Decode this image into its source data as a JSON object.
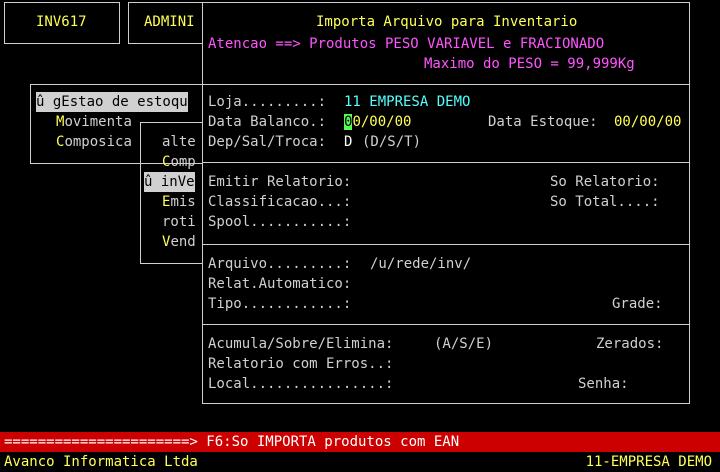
{
  "top_tabs": [
    {
      "label": "INV617"
    },
    {
      "label": "ADMINI"
    }
  ],
  "menu_l1": {
    "selected": "û gEstao de estoqu",
    "items": [
      {
        "hot": "M",
        "rest": "ovimenta"
      },
      {
        "hot": "C",
        "rest": "omposica"
      }
    ]
  },
  "menu_l2": {
    "items": [
      {
        "hot": "",
        "rest": "alte"
      },
      {
        "hot": "C",
        "rest": "omp"
      },
      {
        "selected": true,
        "text": "û inVe"
      },
      {
        "hot": "E",
        "rest": "mis"
      },
      {
        "hot": "",
        "rest": "roti"
      },
      {
        "hot": "V",
        "rest": "end"
      }
    ]
  },
  "dialog": {
    "title": "Importa Arquivo para Inventario",
    "warning": "Atencao ==> Produtos PESO VARIAVEL e FRACIONADO",
    "max_weight": "Maximo do PESO = 99,999Kg",
    "loja_label": "Loja.........:",
    "loja_value": "11 EMPRESA DEMO",
    "data_balanco_label": "Data Balanco.:",
    "data_balanco_first": "0",
    "data_balanco_rest": "0/00/00",
    "data_estoque_label": "Data Estoque:",
    "data_estoque_value": "00/00/00",
    "dep_label": "Dep/Sal/Troca:",
    "dep_value": "D",
    "dep_hint": "(D/S/T)",
    "emitir_label": "Emitir Relatorio:",
    "so_relatorio_label": "So Relatorio:",
    "classificacao_label": "Classificacao...:",
    "so_total_label": "So Total....:",
    "spool_label": "Spool...........:",
    "arquivo_label": "Arquivo.........:",
    "arquivo_value": "/u/rede/inv/",
    "relat_label": "Relat.Automatico:",
    "tipo_label": "Tipo............:",
    "grade_label": "Grade:",
    "acumula_label": "Acumula/Sobre/Elimina:",
    "acumula_hint": "(A/S/E)",
    "zerados_label": "Zerados:",
    "relatorio_erros_label": "Relatorio com Erros..:",
    "local_label": "Local................:",
    "senha_label": "Senha:"
  },
  "status_bar": "======================> F6:So IMPORTA produtos com EAN",
  "footer": {
    "left": "Avanco Informatica Ltda",
    "right": "11-EMPRESA DEMO"
  }
}
